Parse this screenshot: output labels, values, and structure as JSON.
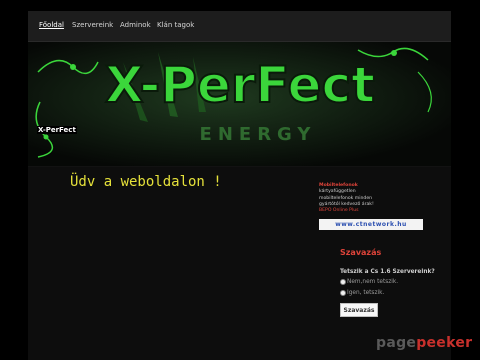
{
  "nav": {
    "items": [
      "Főoldal",
      "Szervereink",
      "Adminok",
      "Klán tagok"
    ]
  },
  "banner": {
    "logo_text": "X-PerFect",
    "background_text": "ENERGY",
    "site_label": "X-PerFect"
  },
  "main": {
    "welcome": "Üdv a weboldalon !"
  },
  "ad": {
    "title": "Mobiltelefonok",
    "line1": "kártyafüggetlen",
    "line2": "mobiltelefonok minden",
    "line3": "gyártótól kedvező árak!",
    "link": "BEPO Online Plus",
    "banner": "www.ctnetwork.hu"
  },
  "poll": {
    "title": "Szavazás",
    "question": "Tetszik a Cs 1.6 Szervereink?",
    "options": [
      "Nem,nem tetszik.",
      "Igen, tetszik."
    ],
    "vote_label": "Szavazás"
  },
  "watermark": {
    "part1": "page",
    "part2": "peeker"
  },
  "colors": {
    "accent": "#e0443a",
    "logo_green": "#3bd63b",
    "welcome_yellow": "#e5e13a"
  }
}
